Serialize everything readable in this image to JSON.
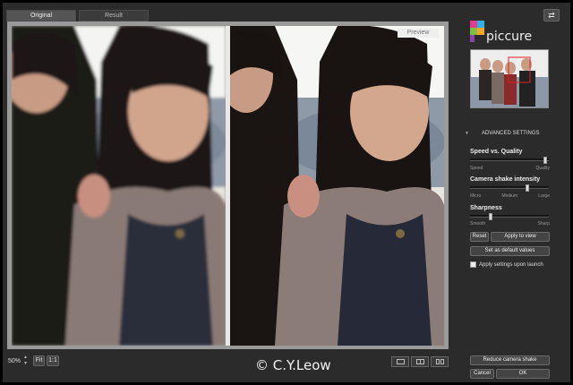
{
  "tabs": [
    {
      "label": "Original",
      "active": true
    },
    {
      "label": "Result",
      "active": false
    }
  ],
  "preview": {
    "tag": "Preview"
  },
  "toolbar": {
    "zoom_value": "50%",
    "fit_label": "Fit",
    "actual_size_label": "1:1",
    "view_modes": [
      "single-view-icon",
      "split-view-icon",
      "side-by-side-icon"
    ]
  },
  "watermark": "© C.Y.Leow",
  "brand": {
    "name": "piccure",
    "colors": [
      "#e63a8c",
      "#2bb3e6",
      "#f5a623",
      "#7ac143"
    ]
  },
  "settings": {
    "header": "ADVANCED SETTINGS",
    "speed_quality": {
      "label": "Speed vs. Quality",
      "min": "Speed",
      "max": "Quality",
      "level": 1.0
    },
    "shake": {
      "label": "Camera shake intensity",
      "min": "Micro",
      "mid": "Medium",
      "max": "Large",
      "level": 0.75
    },
    "sharpness": {
      "label": "Sharpness",
      "min": "Smooth",
      "max": "Sharp",
      "level": 0.25
    },
    "reset_label": "Reset",
    "apply_label": "Apply to view",
    "defaults_label": "Set as default values",
    "launch_label": "Apply settings upon launch",
    "launch_checked": false
  },
  "actions": {
    "reduce_label": "Reduce camera shake",
    "cancel_label": "Cancel",
    "ok_label": "OK"
  }
}
